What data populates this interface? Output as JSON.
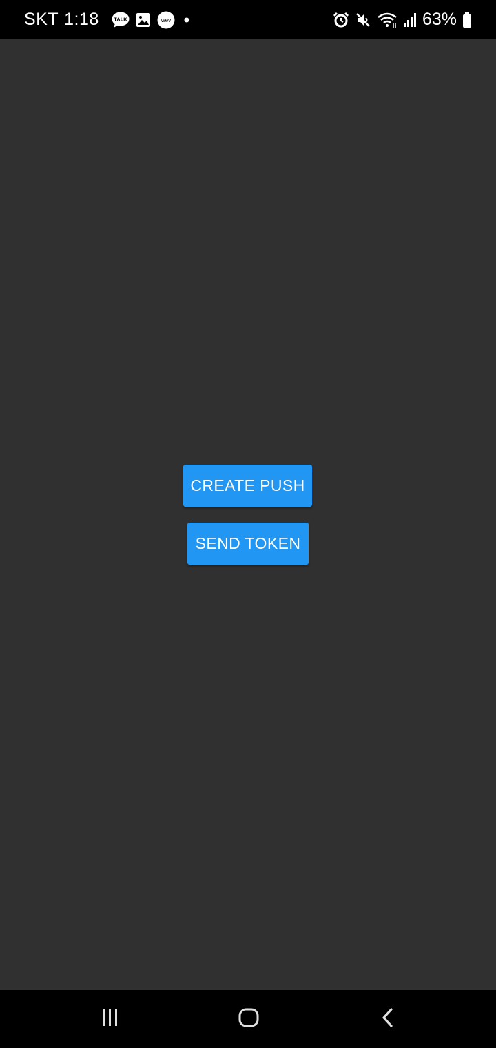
{
  "status_bar": {
    "carrier": "SKT",
    "time": "1:18",
    "battery_percent": "63%",
    "notification_icons": [
      "kakaotalk-icon",
      "gallery-icon",
      "weverse-icon",
      "more-dot-icon"
    ],
    "system_icons": [
      "alarm-icon",
      "mute-icon",
      "wifi-icon",
      "signal-icon",
      "battery-icon"
    ]
  },
  "main": {
    "background_color": "#303030",
    "buttons": {
      "create_push": "CREATE PUSH",
      "send_token": "SEND TOKEN"
    },
    "button_color": "#2196f3"
  },
  "nav_bar": {
    "items": [
      "recents-icon",
      "home-icon",
      "back-icon"
    ]
  },
  "talk_icon_text": "TALK"
}
